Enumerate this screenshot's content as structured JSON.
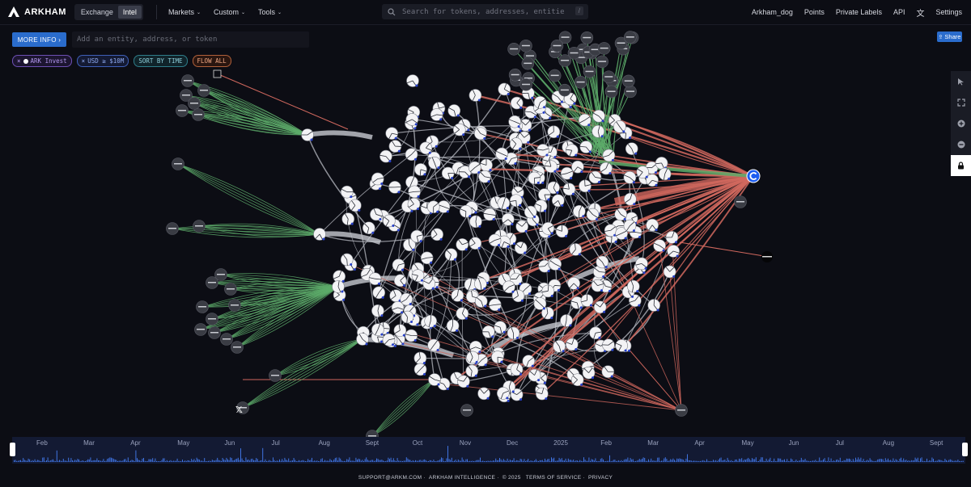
{
  "brand": {
    "name": "ARKHAM"
  },
  "modes": [
    {
      "label": "Exchange"
    },
    {
      "label": "Intel"
    }
  ],
  "nav": [
    {
      "label": "Markets"
    },
    {
      "label": "Custom"
    },
    {
      "label": "Tools"
    }
  ],
  "search": {
    "placeholder": "Search for tokens, addresses, entities...",
    "shortcut": "/"
  },
  "right_nav": [
    {
      "label": "Arkham_dog"
    },
    {
      "label": "Points"
    },
    {
      "label": "Private Labels"
    },
    {
      "label": "API"
    },
    {
      "label": "Settings"
    }
  ],
  "more_info": {
    "label": "MORE INFO ›"
  },
  "entity_input": {
    "placeholder": "Add an entity, address, or token"
  },
  "filters": {
    "ark": "ARK Invest",
    "usd": "USD ≥ $10M",
    "sort": "SORT BY TIME",
    "flow": "FLOW ALL"
  },
  "share": {
    "label": "Share"
  },
  "toolbar": {
    "tools": [
      "pointer-icon",
      "fullscreen-icon",
      "zoom-in-icon",
      "zoom-out-icon",
      "lock-icon"
    ]
  },
  "timeline": {
    "months": [
      "Feb",
      "Mar",
      "Apr",
      "May",
      "Jun",
      "Jul",
      "Aug",
      "Sept",
      "Oct",
      "Nov",
      "Dec",
      "2025",
      "Feb",
      "Mar",
      "Apr",
      "May",
      "Jun",
      "Jul",
      "Aug",
      "Sept"
    ]
  },
  "footer": {
    "email": "SUPPORT@ARKM.COM",
    "company": "ARKHAM INTELLIGENCE",
    "copyright": "© 2025",
    "terms": "TERMS OF SERVICE",
    "privacy": "PRIVACY"
  },
  "colors": {
    "inflow": "#5dab6a",
    "outflow": "#d1685e",
    "accent": "#2a6ccc",
    "background": "#0c0d14"
  }
}
